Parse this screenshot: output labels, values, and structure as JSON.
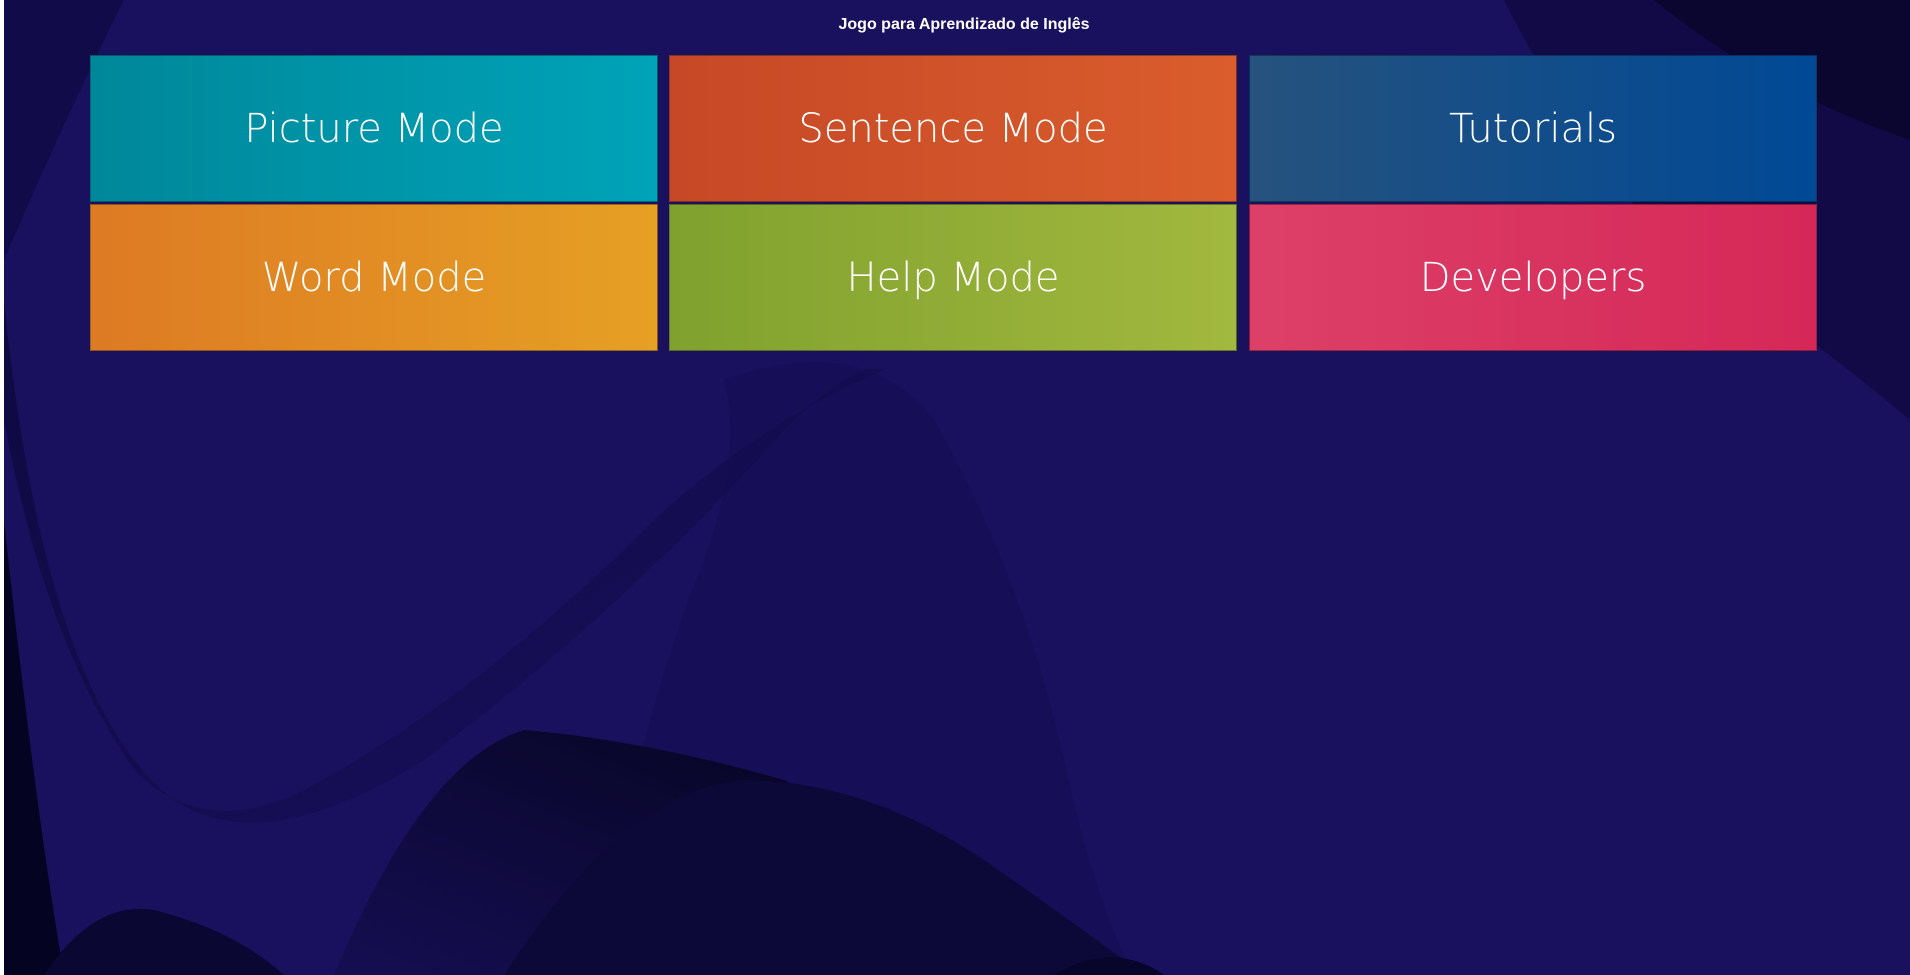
{
  "app": {
    "title": "Jogo para Aprendizado de Inglês",
    "background_color": "#19105e"
  },
  "menu": {
    "tiles": [
      {
        "label": "Picture Mode",
        "color_start": "#00879a",
        "color_end": "#00a3b8"
      },
      {
        "label": "Sentence Mode",
        "color_start": "#c64826",
        "color_end": "#da5d2d"
      },
      {
        "label": "Tutorials",
        "color_start": "#26527d",
        "color_end": "#004996"
      },
      {
        "label": "Word Mode",
        "color_start": "#dd7a24",
        "color_end": "#e6a024"
      },
      {
        "label": "Help Mode",
        "color_start": "#80a12e",
        "color_end": "#a2b83e"
      },
      {
        "label": "Developers",
        "color_start": "#dc4068",
        "color_end": "#d62858"
      }
    ]
  }
}
